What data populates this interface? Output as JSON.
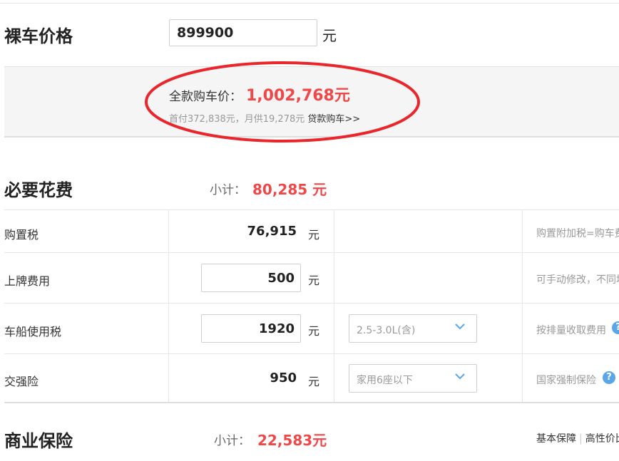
{
  "price": {
    "title": "裸车价格",
    "value": "899900",
    "unit": "元"
  },
  "summary": {
    "total_label": "全款购车价：",
    "total_value": "1,002,768元",
    "down_payment": "首付372,838元，月供19,278元",
    "loan_link": "贷款购车>>",
    "highlight_color": "#e8262b"
  },
  "required": {
    "title": "必要花费",
    "subtotal_label": "小计：",
    "subtotal_value": "80,285 元",
    "rows": [
      {
        "label": "购置税",
        "value": "76,915",
        "unit": "元",
        "note": "购置附加税=购车费"
      },
      {
        "label": "上牌费用",
        "value": "500",
        "unit": "元",
        "note": "可手动修改，不同地"
      },
      {
        "label": "车船使用税",
        "value": "1920",
        "unit": "元",
        "select": "2.5-3.0L(含)",
        "note": "按排量收取费用",
        "help": "?"
      },
      {
        "label": "交强险",
        "value": "950",
        "unit": "元",
        "select": "家用6座以下",
        "note": "国家强制保险",
        "help": "?"
      }
    ]
  },
  "commercial": {
    "title": "商业保险",
    "subtotal_label": "小计：",
    "subtotal_value": "22,583元",
    "links": [
      "基本保障",
      "高性价比"
    ]
  },
  "colors": {
    "accent_red": "#f04848",
    "help_blue": "#5aa6e8"
  }
}
